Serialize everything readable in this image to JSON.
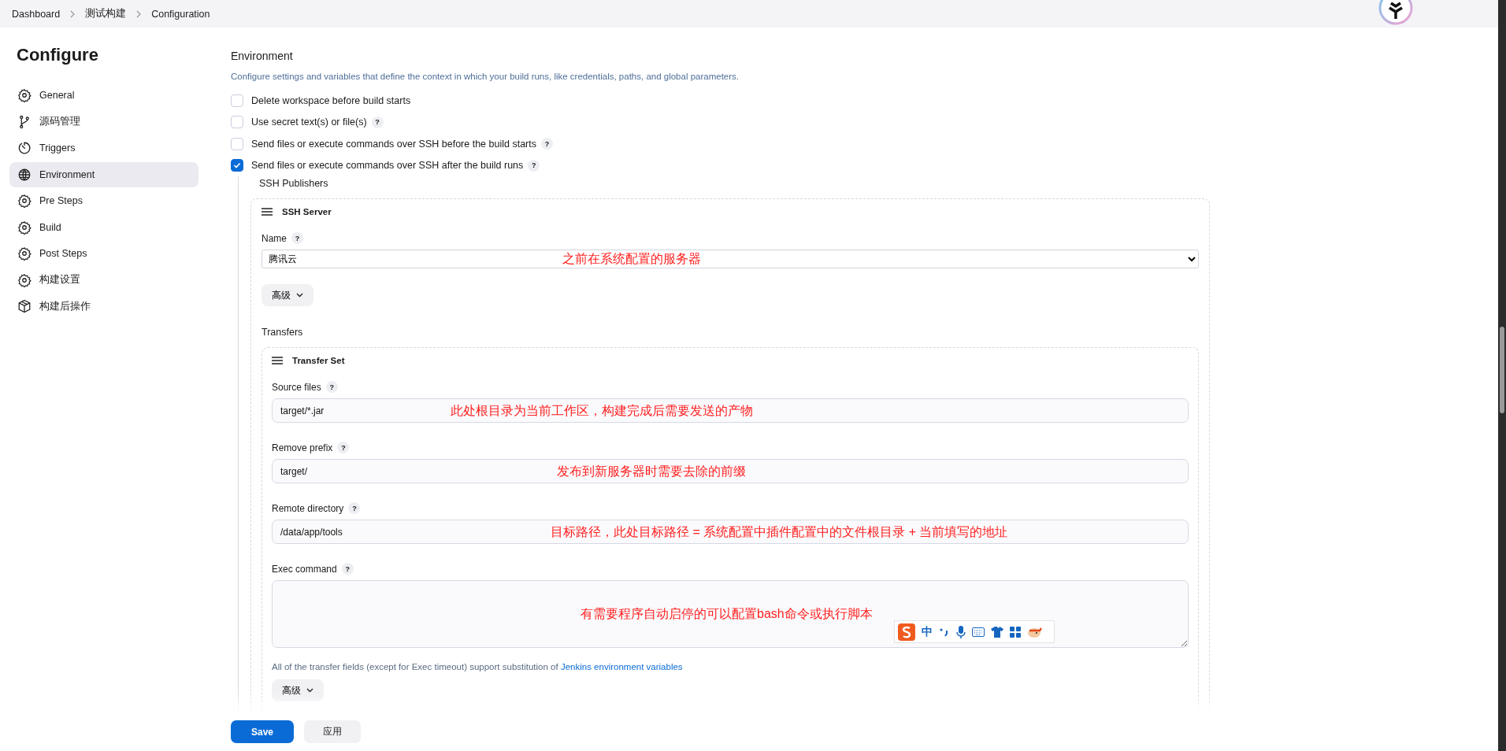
{
  "breadcrumbs": [
    {
      "label": "Dashboard"
    },
    {
      "label": "测试构建"
    },
    {
      "label": "Configuration"
    }
  ],
  "sidebar": {
    "title": "Configure",
    "items": [
      {
        "label": "General",
        "kind": "gear",
        "selected": false
      },
      {
        "label": "源码管理",
        "kind": "branch",
        "selected": false
      },
      {
        "label": "Triggers",
        "kind": "timer",
        "selected": false
      },
      {
        "label": "Environment",
        "kind": "globe",
        "selected": true
      },
      {
        "label": "Pre Steps",
        "kind": "gear",
        "selected": false
      },
      {
        "label": "Build",
        "kind": "gear",
        "selected": false
      },
      {
        "label": "Post Steps",
        "kind": "gear",
        "selected": false
      },
      {
        "label": "构建设置",
        "kind": "gear",
        "selected": false
      },
      {
        "label": "构建后操作",
        "kind": "package",
        "selected": false
      }
    ]
  },
  "section": {
    "title": "Environment",
    "description": "Configure settings and variables that define the context in which your build runs, like credentials, paths, and global parameters.",
    "options": [
      {
        "label": "Delete workspace before build starts",
        "checked": false
      },
      {
        "label": "Use secret text(s) or file(s)",
        "checked": false,
        "help": "?"
      },
      {
        "label": "Send files or execute commands over SSH before the build starts",
        "checked": false,
        "help": "?"
      },
      {
        "label": "Send files or execute commands over SSH after the build runs",
        "checked": true,
        "help": "?"
      }
    ]
  },
  "ssh_publishers": {
    "label": "SSH Publishers",
    "server": {
      "title": "SSH Server",
      "name_label": "Name",
      "name_help": "?",
      "name_value": "腾讯云",
      "name_annotation": "之前在系统配置的服务器",
      "advanced_button": "高级",
      "transfers_label": "Transfers",
      "transfer_set": {
        "title": "Transfer Set",
        "fields": [
          {
            "kind": "input",
            "label": "Source files",
            "help": "?",
            "value": "target/*.jar",
            "annotation": "此处根目录为当前工作区，构建完成后需要发送的产物"
          },
          {
            "kind": "input",
            "label": "Remove prefix",
            "help": "?",
            "value": "target/",
            "annotation": "发布到新服务器时需要去除的前缀"
          },
          {
            "kind": "input",
            "label": "Remote directory",
            "help": "?",
            "value": "/data/app/tools",
            "annotation": "目标路径，此处目标路径 = 系统配置中插件配置中的文件根目录 + 当前填写的地址"
          },
          {
            "kind": "textarea",
            "label": "Exec command",
            "help": "?",
            "annotation": "有需要程序自动启停的可以配置bash命令或执行脚本"
          }
        ],
        "note_text": "All of the transfer fields (except for Exec timeout) support substitution of",
        "note_link": "Jenkins environment variables",
        "advanced_button": "高级"
      }
    }
  },
  "ime_toolbar": {
    "mode": "中"
  },
  "footer": {
    "buttons": [
      {
        "label": "Save",
        "kind": "primary"
      },
      {
        "label": "应用",
        "kind": "secondary"
      }
    ]
  }
}
